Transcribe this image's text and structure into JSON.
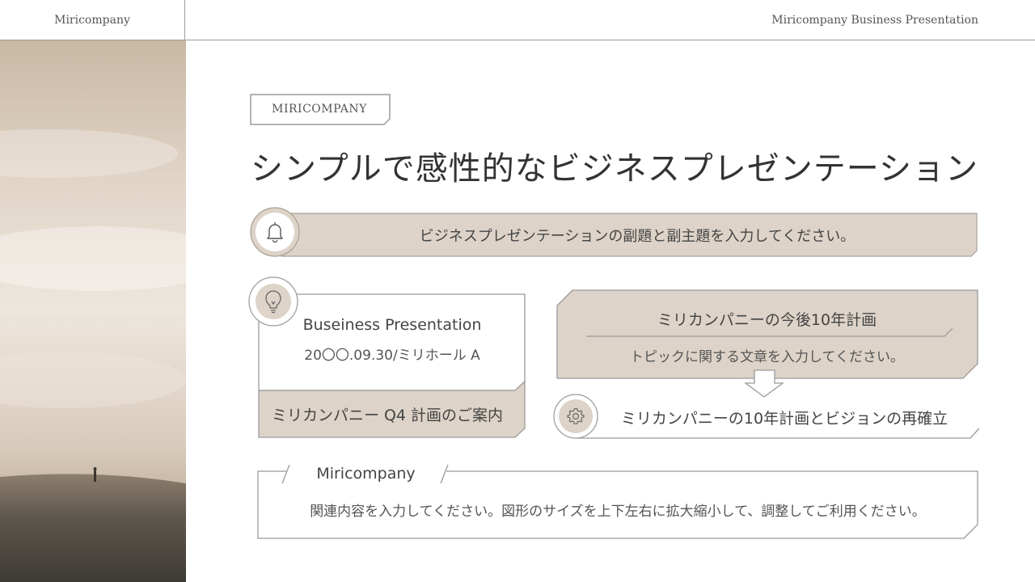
{
  "header": {
    "brand": "Miricompany",
    "title": "Miricompany Business Presentation"
  },
  "tag_label": "MIRICOMPANY",
  "main_title": "シンプルで感性的なビジネスプレゼンテーション",
  "subtitle_bar": {
    "icon": "bell-icon",
    "text": "ビジネスプレゼンテーションの副題と副主題を入力してください。"
  },
  "left_card": {
    "icon": "lightbulb-icon",
    "title": "Buseiness Presentation",
    "date": "20〇〇.09.30/ミリホール A",
    "footer": "ミリカンパニー Q4 計画のご案内"
  },
  "right_card": {
    "title": "ミリカンパニーの今後10年計画",
    "text": "トピックに関する文章を入力してください。",
    "arrow_icon": "arrow-down-icon"
  },
  "vision_bar": {
    "icon": "gear-icon",
    "text": "ミリカンパニーの10年計画とビジョンの再確立"
  },
  "bottom_box": {
    "label": "Miricompany",
    "text": "関連内容を入力してください。図形のサイズを上下左右に拡大縮小して、調整してご利用ください。"
  },
  "colors": {
    "beige": "#ddd3c8",
    "border": "#9a9a9a",
    "text": "#444444"
  }
}
